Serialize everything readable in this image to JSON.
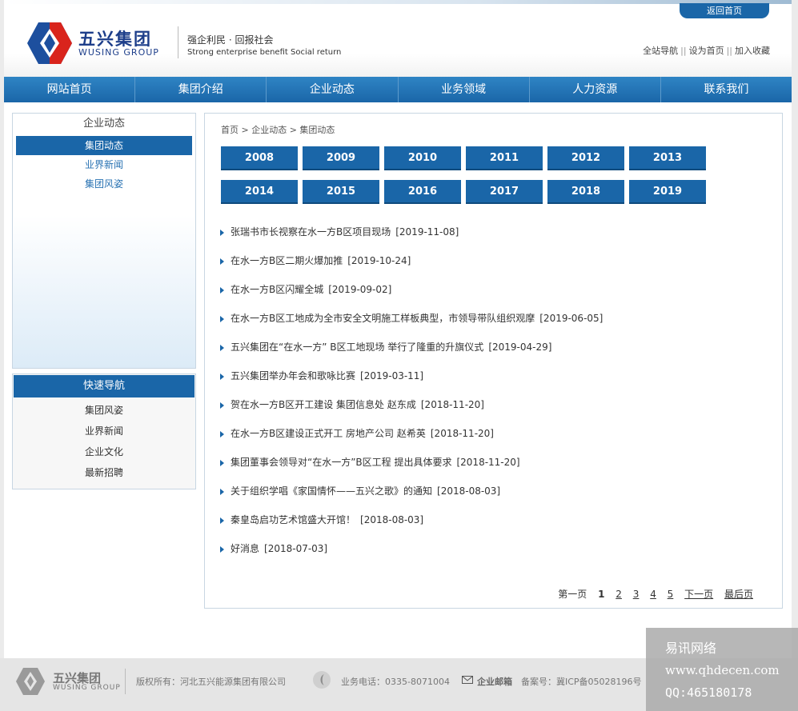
{
  "header": {
    "back_home": "返回首页",
    "brand_cn": "五兴集团",
    "brand_en": "WUSING GROUP",
    "slogan_cn": "强企利民 · 回报社会",
    "slogan_en": "Strong enterprise benefit Social return",
    "links": [
      "全站导航",
      "设为首页",
      "加入收藏"
    ],
    "link_sep": "||"
  },
  "nav": [
    "网站首页",
    "集团介绍",
    "企业动态",
    "业务领域",
    "人力资源",
    "联系我们"
  ],
  "sidebar": {
    "title": "企业动态",
    "items": [
      {
        "label": "集团动态",
        "active": true
      },
      {
        "label": "业界新闻",
        "active": false
      },
      {
        "label": "集团风姿",
        "active": false
      }
    ],
    "quick_title": "快速导航",
    "quick_items": [
      "集团风姿",
      "业界新闻",
      "企业文化",
      "最新招聘"
    ]
  },
  "main": {
    "breadcrumb": "首页 > 企业动态 > 集团动态",
    "years": [
      "2008",
      "2009",
      "2010",
      "2011",
      "2012",
      "2013",
      "2014",
      "2015",
      "2016",
      "2017",
      "2018",
      "2019"
    ],
    "news": [
      {
        "title": "张瑞书市长视察在水一方B区项目现场",
        "date": "[2019-11-08]"
      },
      {
        "title": "在水一方B区二期火爆加推",
        "date": "[2019-10-24]"
      },
      {
        "title": "在水一方B区闪耀全城",
        "date": "[2019-09-02]"
      },
      {
        "title": "在水一方B区工地成为全市安全文明施工样板典型，市领导带队组织观摩",
        "date": "[2019-06-05]"
      },
      {
        "title": "五兴集团在“在水一方” B区工地现场 举行了隆重的升旗仪式",
        "date": "[2019-04-29]"
      },
      {
        "title": "五兴集团举办年会和歌咏比赛",
        "date": "[2019-03-11]"
      },
      {
        "title": "贺在水一方B区开工建设 集团信息处 赵东成",
        "date": "[2018-11-20]"
      },
      {
        "title": "在水一方B区建设正式开工 房地产公司 赵希英",
        "date": "[2018-11-20]"
      },
      {
        "title": "集团董事会领导对“在水一方”B区工程 提出具体要求",
        "date": "[2018-11-20]"
      },
      {
        "title": "关于组织学唱《家国情怀——五兴之歌》的通知",
        "date": "[2018-08-03]"
      },
      {
        "title": "秦皇岛启功艺术馆盛大开馆！",
        "date": "[2018-08-03]"
      },
      {
        "title": "好消息",
        "date": "[2018-07-03]"
      }
    ],
    "pager": {
      "first": "第一页",
      "pages": [
        "1",
        "2",
        "3",
        "4",
        "5"
      ],
      "current": "1",
      "next": "下一页",
      "last": "最后页"
    }
  },
  "footer": {
    "brand_cn": "五兴集团",
    "brand_en": "WUSING GROUP",
    "copyright": "版权所有：河北五兴能源集团有限公司",
    "phone": "业务电话：0335-8071004",
    "mail": "企业邮箱",
    "icp": "备案号：冀ICP备05028196号"
  },
  "watermark": {
    "line1": "易讯网络",
    "line2": "www.qhdecen.com",
    "line3": "QQ:465180178"
  },
  "colors": {
    "primary": "#1a66a8",
    "link": "#2a73b3"
  }
}
